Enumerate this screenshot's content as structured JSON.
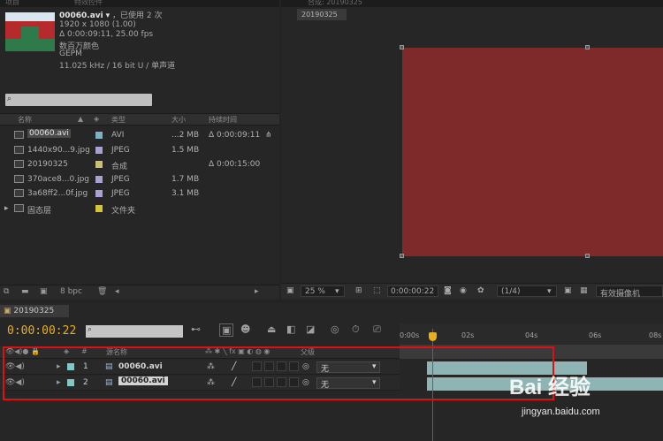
{
  "project": {
    "tab_a": "项目",
    "tab_b": "特效控件",
    "selected": {
      "name": "00060.avi",
      "name_suffix": "▾",
      "usage": "，已使用 2 次",
      "dimensions": "1920 x 1080 (1.00)",
      "duration": "Δ 0:00:09:11, 25.00 fps",
      "color": "数百万颜色",
      "codec": "GEPM",
      "audio": "11.025 kHz / 16 bit U / 单声道"
    },
    "columns": [
      "名称",
      "类型",
      "大小",
      "持续时间"
    ],
    "files": [
      {
        "name": "00060.avi",
        "type": "AVI",
        "size": "...2 MB",
        "duration": "Δ 0:00:09:11",
        "color": "#7fb0c4"
      },
      {
        "name": "1440x90...9.jpg",
        "type": "JPEG",
        "size": "1.5 MB",
        "duration": "",
        "color": "#a8a2d0"
      },
      {
        "name": "20190325",
        "type": "合成",
        "size": "",
        "duration": "Δ 0:00:15:00",
        "color": "#c8c078"
      },
      {
        "name": "370ace8...0.jpg",
        "type": "JPEG",
        "size": "1.7 MB",
        "duration": "",
        "color": "#a8a2d0"
      },
      {
        "name": "3a68ff2...0f.jpg",
        "type": "JPEG",
        "size": "3.1 MB",
        "duration": "",
        "color": "#a8a2d0"
      },
      {
        "name": "固态层",
        "type": "文件夹",
        "size": "",
        "duration": "",
        "color": "#d4c438"
      }
    ],
    "bit_depth": "8 bpc"
  },
  "viewer": {
    "tab": "20190325",
    "tab_header": "合成: 20190325",
    "zoom": "25 %",
    "timecode": "0:00:00:22",
    "resolution": "(1/4)",
    "camera": "有效摄像机"
  },
  "timeline": {
    "tab": "20190325",
    "timecode": "0:00:00:22",
    "header": {
      "name_col": "源名称",
      "parent_col": "父级"
    },
    "layers": [
      {
        "num": "1",
        "name": "00060.avi",
        "parent": "无"
      },
      {
        "num": "2",
        "name": "00060.avi",
        "parent": "无"
      }
    ],
    "ruler": [
      "0:00s",
      "02s",
      "04s",
      "06s",
      "08s"
    ]
  },
  "watermark": {
    "logo": "Bai 经验",
    "url": "jingyan.baidu.com"
  },
  "colors": {
    "accent_timecode": "#e8b020",
    "highlight": "#e01010",
    "layer_bar": "#8fb4b4"
  }
}
